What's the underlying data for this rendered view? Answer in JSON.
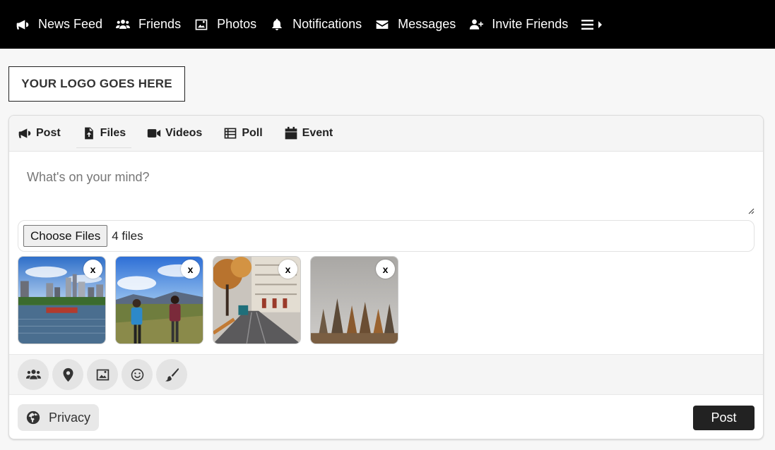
{
  "nav": {
    "items": [
      {
        "label": "News Feed",
        "icon": "megaphone-icon"
      },
      {
        "label": "Friends",
        "icon": "users-icon"
      },
      {
        "label": "Photos",
        "icon": "image-icon"
      },
      {
        "label": "Notifications",
        "icon": "bell-icon"
      },
      {
        "label": "Messages",
        "icon": "envelope-icon"
      },
      {
        "label": "Invite Friends",
        "icon": "user-plus-icon"
      }
    ],
    "more_icon": "menu-caret-icon"
  },
  "logo": {
    "text": "YOUR LOGO GOES HERE"
  },
  "tabs": [
    {
      "label": "Post",
      "icon": "megaphone-icon"
    },
    {
      "label": "Files",
      "icon": "file-upload-icon"
    },
    {
      "label": "Videos",
      "icon": "video-icon"
    },
    {
      "label": "Poll",
      "icon": "list-icon"
    },
    {
      "label": "Event",
      "icon": "calendar-icon"
    }
  ],
  "composer": {
    "placeholder": "What's on your mind?",
    "value": ""
  },
  "files": {
    "button_label": "Choose Files",
    "count_text": "4 files"
  },
  "thumbnails": [
    {
      "scene": "city-skyline-river",
      "close": "x"
    },
    {
      "scene": "hikers-mountains",
      "close": "x"
    },
    {
      "scene": "autumn-street-tram",
      "close": "x"
    },
    {
      "scene": "foggy-forest",
      "close": "x"
    }
  ],
  "action_icons": [
    "users-icon",
    "location-pin-icon",
    "image-icon",
    "smiley-icon",
    "paintbrush-icon"
  ],
  "footer": {
    "privacy_label": "Privacy",
    "post_label": "Post"
  },
  "colors": {
    "nav_bg": "#000000",
    "post_button_bg": "#222222",
    "page_bg": "#f7f7f7"
  }
}
